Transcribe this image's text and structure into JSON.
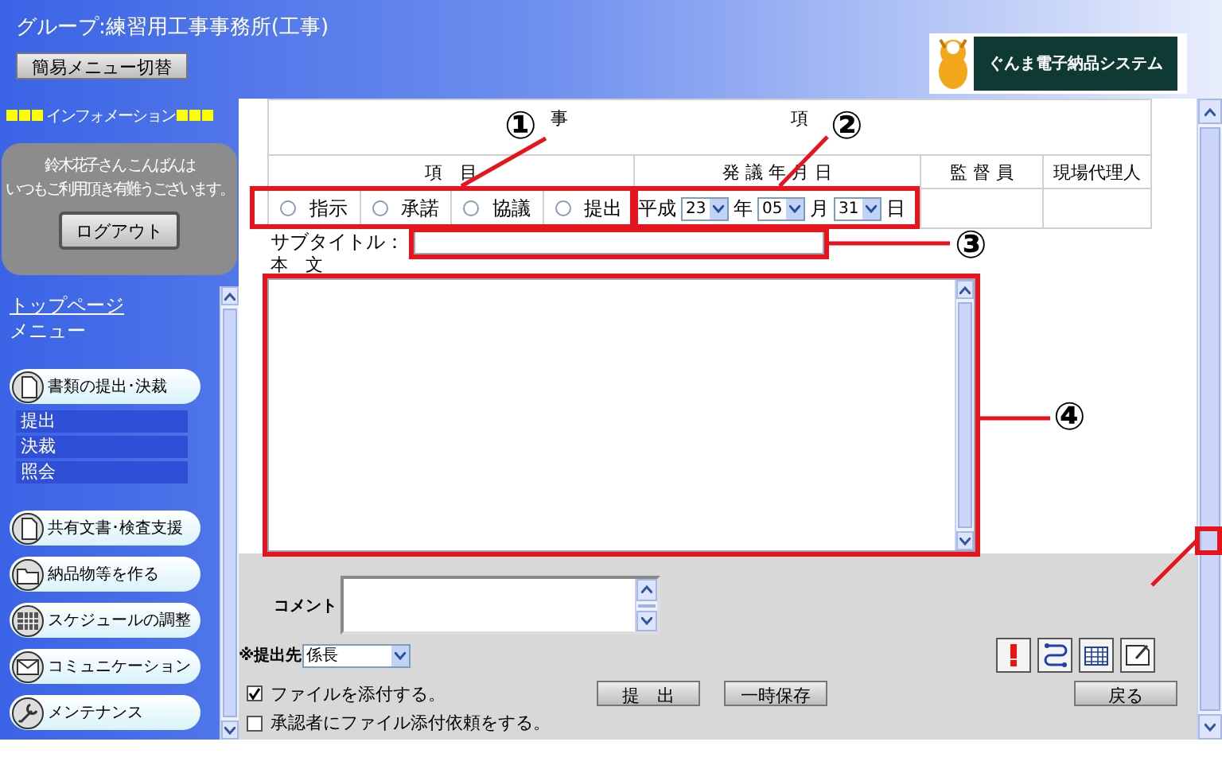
{
  "header": {
    "group": "グループ:練習用工事事務所(工事)",
    "menu_toggle": "簡易メニュー切替",
    "logo_text": "ぐんま電子納品システム"
  },
  "info": {
    "title": "インフォメーション",
    "greeting": "鈴木花子さん こんばんは",
    "message": "いつもご利用頂き有難うございます。",
    "logout": "ログアウト"
  },
  "links": [
    {
      "label": "トップページ",
      "kind": "link"
    },
    {
      "label": "メニュー",
      "kind": "heading"
    }
  ],
  "nav": [
    {
      "label": "書類の提出･決裁",
      "kind": "document",
      "expanded": true,
      "children": [
        {
          "label": "提出"
        },
        {
          "label": "決裁"
        },
        {
          "label": "照会"
        }
      ]
    },
    {
      "label": "共有文書･検査支援",
      "kind": "document"
    },
    {
      "label": "納品物等を作る",
      "kind": "folder"
    },
    {
      "label": "スケジュールの調整",
      "kind": "calendar"
    },
    {
      "label": "コミュニケーション",
      "kind": "mail"
    },
    {
      "label": "メンテナンス",
      "kind": "wrench"
    }
  ],
  "form": {
    "title_chars": [
      "事",
      "項"
    ],
    "columns": [
      "項　目",
      "発 議 年 月 日",
      "監 督 員",
      "現場代理人"
    ],
    "types": [
      {
        "label": "指示",
        "selected": false
      },
      {
        "label": "承諾",
        "selected": false
      },
      {
        "label": "協議",
        "selected": false
      },
      {
        "label": "提出",
        "selected": false
      }
    ],
    "date": {
      "era": "平成",
      "year": "23",
      "year_unit": "年",
      "month": "05",
      "month_unit": "月",
      "day": "31",
      "day_unit": "日"
    },
    "subtitle_label": "サブタイトル：",
    "body_label": "本　文"
  },
  "footer": {
    "comment_label": "コメント",
    "recipient_label": "※提出先",
    "recipient": "係長",
    "options": [
      {
        "label": "ファイルを添付する。",
        "checked": true
      },
      {
        "label": "承認者にファイル添付依頼をする。",
        "checked": false
      }
    ],
    "tools": [
      {
        "kind": "alert"
      },
      {
        "kind": "route"
      },
      {
        "kind": "calendar"
      },
      {
        "kind": "note"
      }
    ],
    "buttons": [
      {
        "label": "提　出"
      },
      {
        "label": "一時保存"
      },
      {
        "label": "戻る"
      }
    ]
  },
  "annotations": [
    {
      "number": "①"
    },
    {
      "number": "②"
    },
    {
      "number": "③"
    },
    {
      "number": "④"
    }
  ]
}
